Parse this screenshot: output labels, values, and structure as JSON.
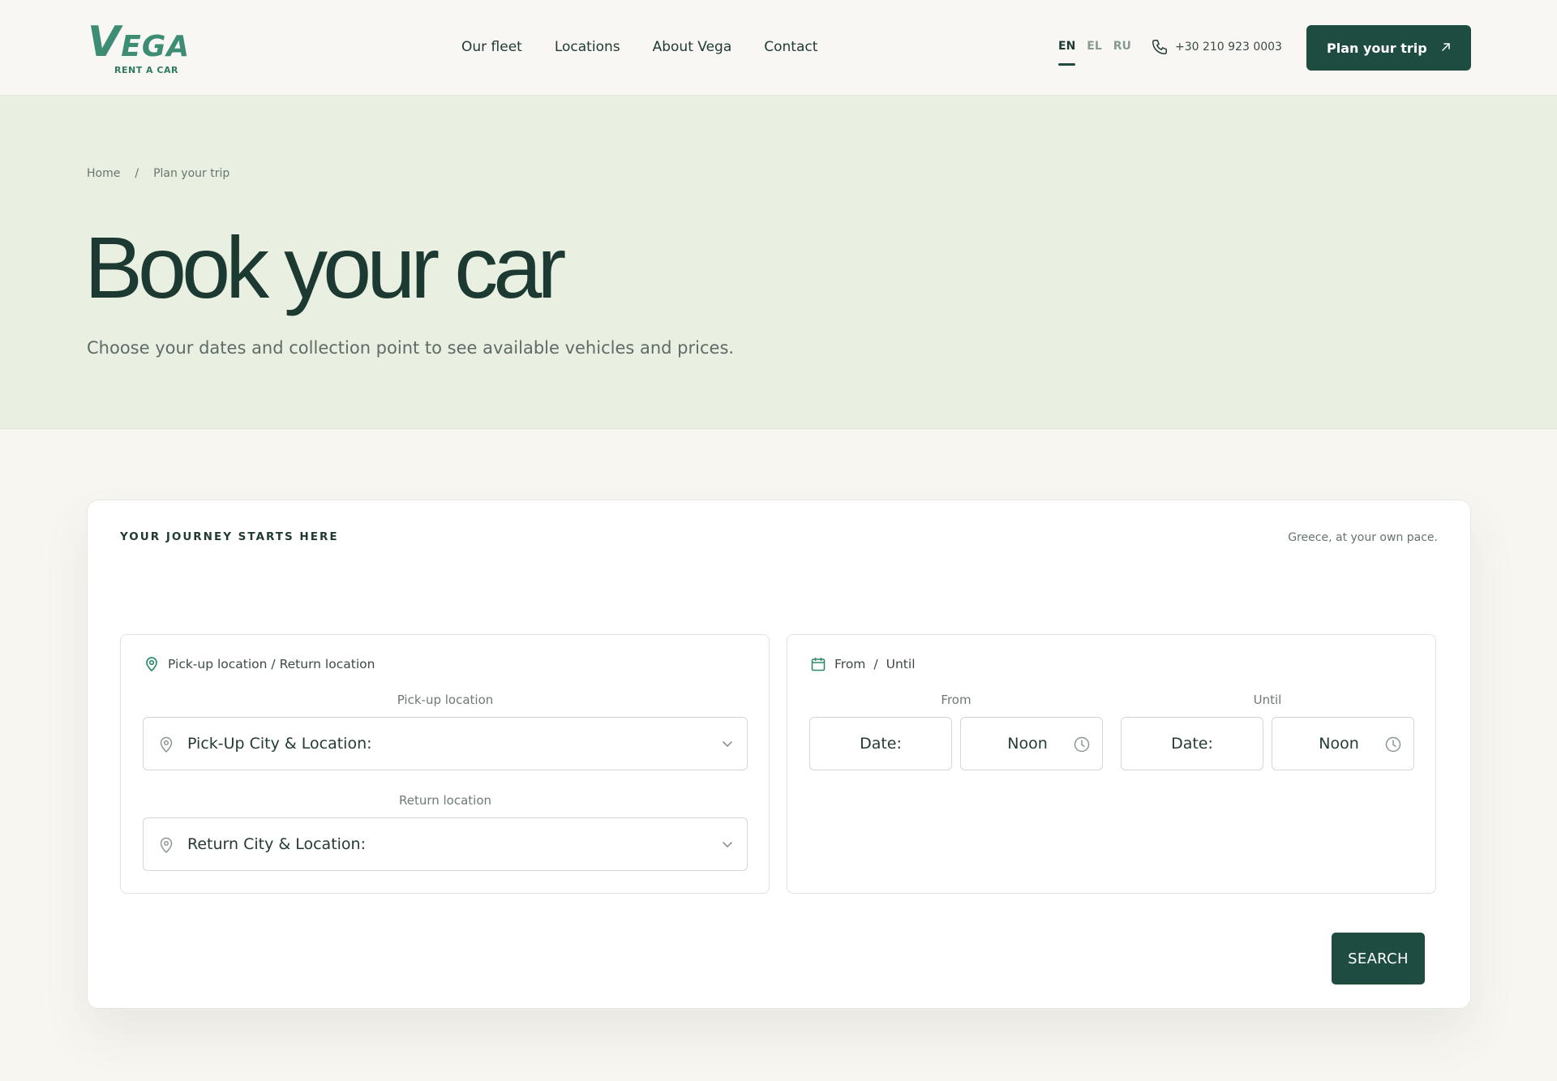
{
  "brand": {
    "logo_word": "VEGA",
    "logo_sub": "RENT A CAR",
    "accent_color": "#1e4c41",
    "logo_color": "#3d8c74"
  },
  "nav": {
    "items": [
      "Our fleet",
      "Locations",
      "About Vega",
      "Contact"
    ]
  },
  "languages": {
    "items": [
      "EN",
      "EL",
      "RU"
    ],
    "active": "EN"
  },
  "contact": {
    "phone_icon": "phone-icon",
    "phone": "+30 210 923 0003"
  },
  "header_cta": {
    "label": "Plan your trip",
    "icon": "arrow-up-right-icon"
  },
  "hero": {
    "breadcrumb": [
      "Home",
      "/",
      "Plan your trip"
    ],
    "title": "Book your car",
    "subtitle": "Choose your dates and collection point to see available vehicles and prices."
  },
  "booking": {
    "eyebrow": "YOUR JOURNEY STARTS HERE",
    "tagline": "Greece, at your own pace.",
    "location_panel": {
      "icon": "location-pin-icon",
      "heading": "Pick-up location / Return location",
      "pickup_label": "Pick-up location",
      "pickup_value": "Pick-Up City & Location:",
      "return_label": "Return location",
      "return_value": "Return City & Location:"
    },
    "date_panel": {
      "icon": "calendar-icon",
      "heading_from": "From",
      "heading_sep": "/",
      "heading_until": "Until",
      "from_label": "From",
      "until_label": "Until",
      "from_date": "Date:",
      "from_time": "Noon",
      "until_date": "Date:",
      "until_time": "Noon"
    },
    "search_label": "SEARCH"
  }
}
